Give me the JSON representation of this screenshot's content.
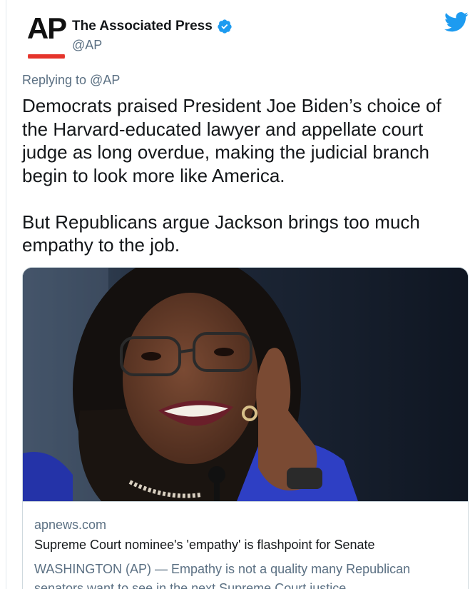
{
  "tweet": {
    "author_name": "The Associated Press",
    "author_handle": "@AP",
    "avatar_logo_text": "AP",
    "reply_context": "Replying to @AP",
    "text": "Democrats praised President Joe Biden’s choice of\nthe Harvard-educated lawyer and appellate court\njudge as long overdue, making the judicial branch\nbegin to look more like America.\n\nBut Republicans argue Jackson brings too much\nempathy to the job."
  },
  "link_card": {
    "domain": "apnews.com",
    "title": "Supreme Court nominee's 'empathy' is flashpoint for Senate",
    "description": "WASHINGTON (AP) — Empathy is not a quality many Republican senators want to see in the next Supreme Court justice."
  },
  "icons": {
    "verified": "verified-badge-icon",
    "brand": "twitter-bird-icon"
  },
  "colors": {
    "twitter_blue": "#1d9bf0",
    "secondary_text": "#5b7083",
    "ap_red": "#e5342b"
  }
}
